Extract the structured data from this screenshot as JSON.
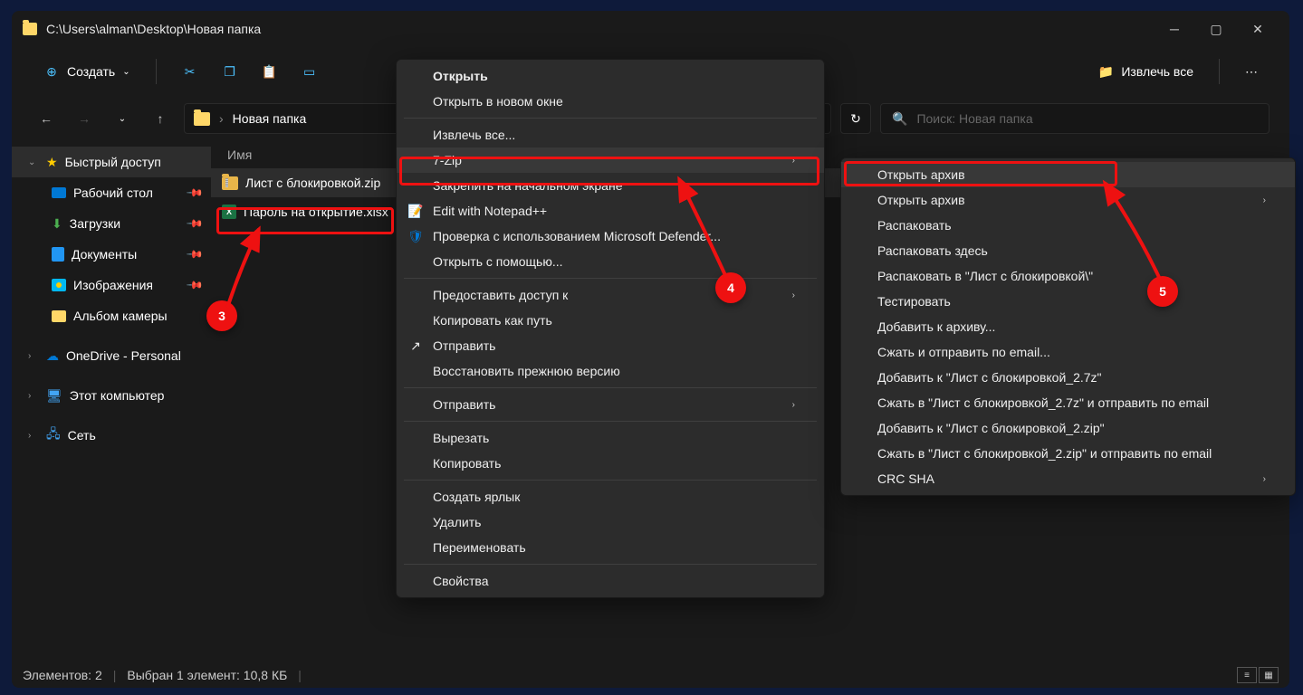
{
  "title_path": "C:\\Users\\alman\\Desktop\\Новая папка",
  "toolbar": {
    "create": "Создать",
    "extract_all": "Извлечь все"
  },
  "breadcrumb": "Новая папка",
  "search_placeholder": "Поиск: Новая папка",
  "column_name": "Имя",
  "sidebar": {
    "quick": "Быстрый доступ",
    "desktop": "Рабочий стол",
    "downloads": "Загрузки",
    "documents": "Документы",
    "pictures": "Изображения",
    "camera": "Альбом камеры",
    "onedrive": "OneDrive - Personal",
    "thispc": "Этот компьютер",
    "network": "Сеть"
  },
  "files": {
    "f1": "Лист с блокировкой.zip",
    "f2": "Пароль на открытие.xlsx"
  },
  "status": {
    "items": "Элементов: 2",
    "selected": "Выбран 1 элемент: 10,8 КБ"
  },
  "ctx1": {
    "title": "Открыть",
    "open_new": "Открыть в новом окне",
    "extract": "Извлечь все...",
    "sevenzip": "7-Zip",
    "pin_start": "Закрепить на начальном экране",
    "notepad": "Edit with Notepad++",
    "defender": "Проверка с использованием Microsoft Defender...",
    "open_with": "Открыть с помощью...",
    "share_access": "Предоставить доступ к",
    "copy_path": "Копировать как путь",
    "send": "Отправить",
    "restore": "Восстановить прежнюю версию",
    "send2": "Отправить",
    "cut": "Вырезать",
    "copy": "Копировать",
    "shortcut": "Создать ярлык",
    "delete": "Удалить",
    "rename": "Переименовать",
    "props": "Свойства"
  },
  "ctx2": {
    "open_arc": "Открыть архив",
    "open_arc2": "Открыть архив",
    "extract": "Распаковать",
    "extract_here": "Распаковать здесь",
    "extract_to": "Распаковать в \"Лист с блокировкой\\\"",
    "test": "Тестировать",
    "add": "Добавить к архиву...",
    "compress_email": "Сжать и отправить по email...",
    "add_7z": "Добавить к \"Лист с блокировкой_2.7z\"",
    "compress_7z": "Сжать в \"Лист с блокировкой_2.7z\" и отправить по email",
    "add_zip": "Добавить к \"Лист с блокировкой_2.zip\"",
    "compress_zip": "Сжать в \"Лист с блокировкой_2.zip\" и отправить по email",
    "crc": "CRC SHA"
  },
  "badges": {
    "b3": "3",
    "b4": "4",
    "b5": "5"
  }
}
